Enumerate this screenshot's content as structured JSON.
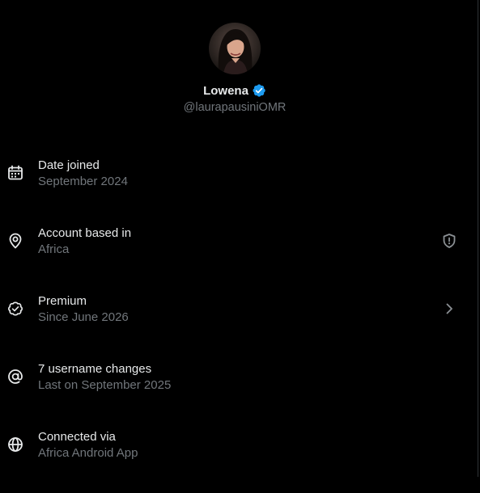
{
  "profile": {
    "name": "Lowena",
    "handle": "@laurapausiniOMR",
    "verified_color": "#1d9bf0"
  },
  "rows": [
    {
      "icon": "calendar-icon",
      "title": "Date joined",
      "subtitle": "September 2024"
    },
    {
      "icon": "location-pin-icon",
      "title": "Account based in",
      "subtitle": "Africa",
      "trailing_icon": "shield-alert-icon"
    },
    {
      "icon": "verified-badge-icon",
      "title": "Premium",
      "subtitle": "Since June 2026",
      "trailing_icon": "chevron-right-icon"
    },
    {
      "icon": "at-sign-icon",
      "title": "7 username changes",
      "subtitle": "Last on September 2025"
    },
    {
      "icon": "globe-icon",
      "title": "Connected via",
      "subtitle": "Africa Android App"
    }
  ],
  "colors": {
    "background": "#000000",
    "primary_text": "#e7e9ea",
    "secondary_text": "#71767b",
    "accent": "#1d9bf0"
  }
}
